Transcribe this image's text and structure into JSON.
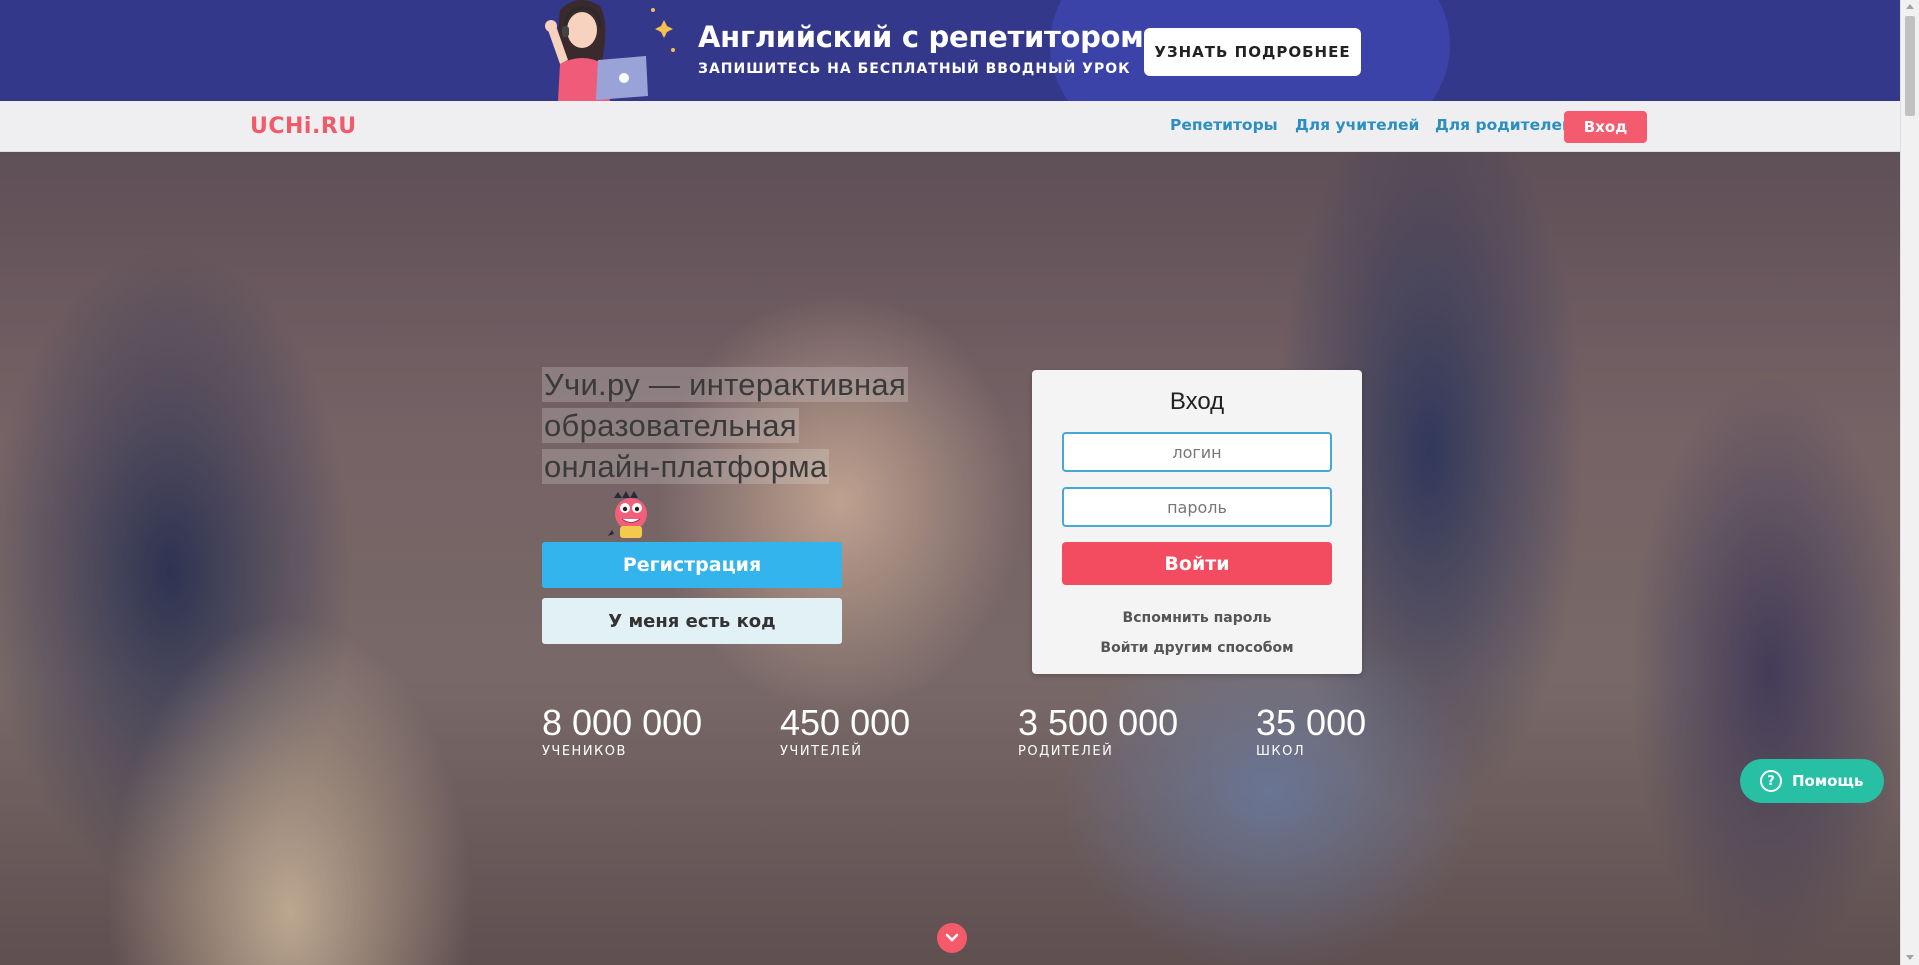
{
  "promo": {
    "title": "Английский с репетитором",
    "subtitle": "ЗАПИШИТЕСЬ НА БЕСПЛАТНЫЙ ВВОДНЫЙ УРОК",
    "button_label": "УЗНАТЬ ПОДРОБНЕЕ",
    "background_color": "#34388a",
    "illustration": "tutor-with-headset-and-laptop"
  },
  "nav": {
    "logo": "UCHi.RU",
    "links": [
      "Репетиторы",
      "Для учителей",
      "Для родителей"
    ],
    "login_label": "Вход",
    "accent_color": "#f45b6e"
  },
  "hero": {
    "tagline_lines": [
      "Учи.ру — интерактивная",
      "образовательная",
      "онлайн-платформа"
    ],
    "register_label": "Регистрация",
    "code_label": "У меня есть код",
    "stats": [
      {
        "value": "8 000 000",
        "label": "УЧЕНИКОВ"
      },
      {
        "value": "450 000",
        "label": "УЧИТЕЛЕЙ"
      },
      {
        "value": "3 500 000",
        "label": "РОДИТЕЛЕЙ"
      },
      {
        "value": "35 000",
        "label": "ШКОЛ"
      }
    ],
    "background": "classroom-photo-girl-with-tablet"
  },
  "login_card": {
    "title": "Вход",
    "login_placeholder": "логин",
    "password_placeholder": "пароль",
    "submit_label": "Войти",
    "forgot_label": "Вспомнить пароль",
    "alt_login_label": "Войти другим способом"
  },
  "help": {
    "label": "Помощь",
    "color": "#27c0a5"
  }
}
